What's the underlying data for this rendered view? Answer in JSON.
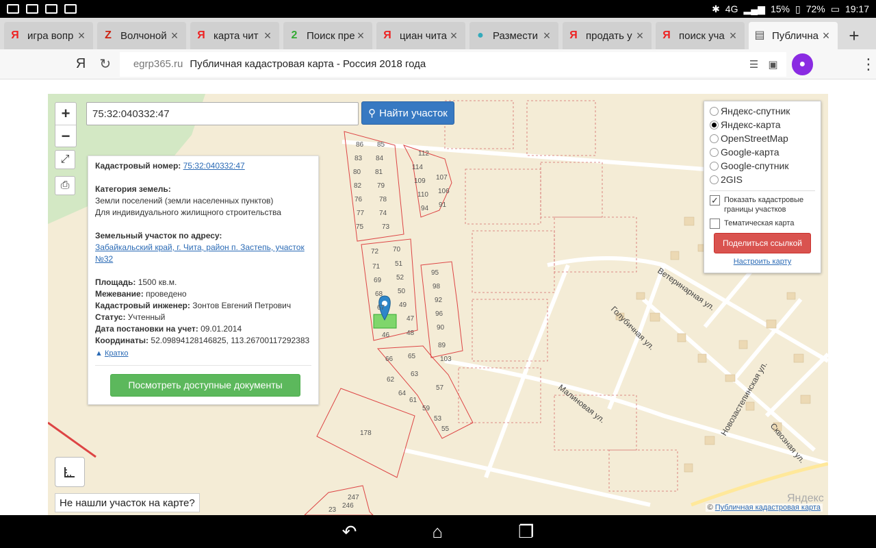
{
  "status_bar": {
    "battery_left": "15%",
    "battery_right": "72%",
    "network": "4G",
    "time": "19:17"
  },
  "tabs": [
    {
      "favicon": "Я",
      "title": "игра вопр"
    },
    {
      "favicon": "Z",
      "title": "Волчоной"
    },
    {
      "favicon": "Я",
      "title": "карта чит"
    },
    {
      "favicon": "2",
      "title": "Поиск пре"
    },
    {
      "favicon": "Я",
      "title": "циан чита"
    },
    {
      "favicon": "●",
      "title": "Размести"
    },
    {
      "favicon": "Я",
      "title": "продать у"
    },
    {
      "favicon": "Я",
      "title": "поиск уча"
    },
    {
      "favicon": "▤",
      "title": "Публична"
    }
  ],
  "toolbar": {
    "logo": "Я",
    "domain": "egrp365.ru",
    "page_title": "Публичная кадастровая карта - Россия 2018 года"
  },
  "map": {
    "zoom_in": "+",
    "zoom_out": "−",
    "search_value": "75:32:040332:47",
    "find_button": "Найти участок",
    "not_found": "Не нашли участок на карте?",
    "attribution_link": "Публичная кадастровая карта",
    "attribution_prefix": "©",
    "yandex_watermark": "Яндекс",
    "streets": {
      "veterinary": "Ветеринарная ул.",
      "golubichnaya": "Голубичная ул.",
      "malinovaya": "Малиновая ул.",
      "novozastepinskaya": "Новозастепинская ул.",
      "skvoznaya": "Сквозная ул."
    }
  },
  "info": {
    "cadastral_label": "Кадастровый номер:",
    "cadastral_value": "75:32:040332:47",
    "category_label": "Категория земель:",
    "category_value": "Земли поселений (земли населенных пунктов)",
    "use_value": "Для индивидуального жилищного строительства",
    "address_label": "Земельный участок по адресу:",
    "address_value": "Забайкальский край, г. Чита, район п. Застепь, участок №32",
    "area_label": "Площадь:",
    "area_value": "1500 кв.м.",
    "survey_label": "Межевание:",
    "survey_value": "проведено",
    "engineer_label": "Кадастровый инженер:",
    "engineer_value": "Зонтов Евгений Петрович",
    "status_label": "Статус:",
    "status_value": "Учтенный",
    "date_label": "Дата постановки на учет:",
    "date_value": "09.01.2014",
    "coords_label": "Координаты:",
    "coords_value": "52.09894128146825, 113.26700117292383",
    "short_link": "Кратко",
    "docs_button": "Посмотреть доступные документы"
  },
  "layers": {
    "options": [
      "Яндекс-спутник",
      "Яндекс-карта",
      "OpenStreetMap",
      "Google-карта",
      "Google-спутник",
      "2GIS"
    ],
    "selected": "Яндекс-карта",
    "show_borders": "Показать кадастровые границы участков",
    "thematic": "Тематическая карта",
    "share_button": "Поделиться ссылкой",
    "setup_link": "Настроить карту"
  },
  "parcels": [
    "85",
    "86",
    "84",
    "83",
    "81",
    "80",
    "79",
    "82",
    "78",
    "76",
    "74",
    "77",
    "73",
    "75",
    "112",
    "114",
    "107",
    "109",
    "106",
    "110",
    "94",
    "91",
    "70",
    "72",
    "51",
    "71",
    "52",
    "69",
    "50",
    "68",
    "49",
    "67",
    "47",
    "46",
    "48",
    "66",
    "65",
    "62",
    "63",
    "64",
    "57",
    "61",
    "59",
    "53",
    "55",
    "95",
    "98",
    "92",
    "96",
    "90",
    "89",
    "103",
    "178",
    "247",
    "246",
    "23"
  ]
}
